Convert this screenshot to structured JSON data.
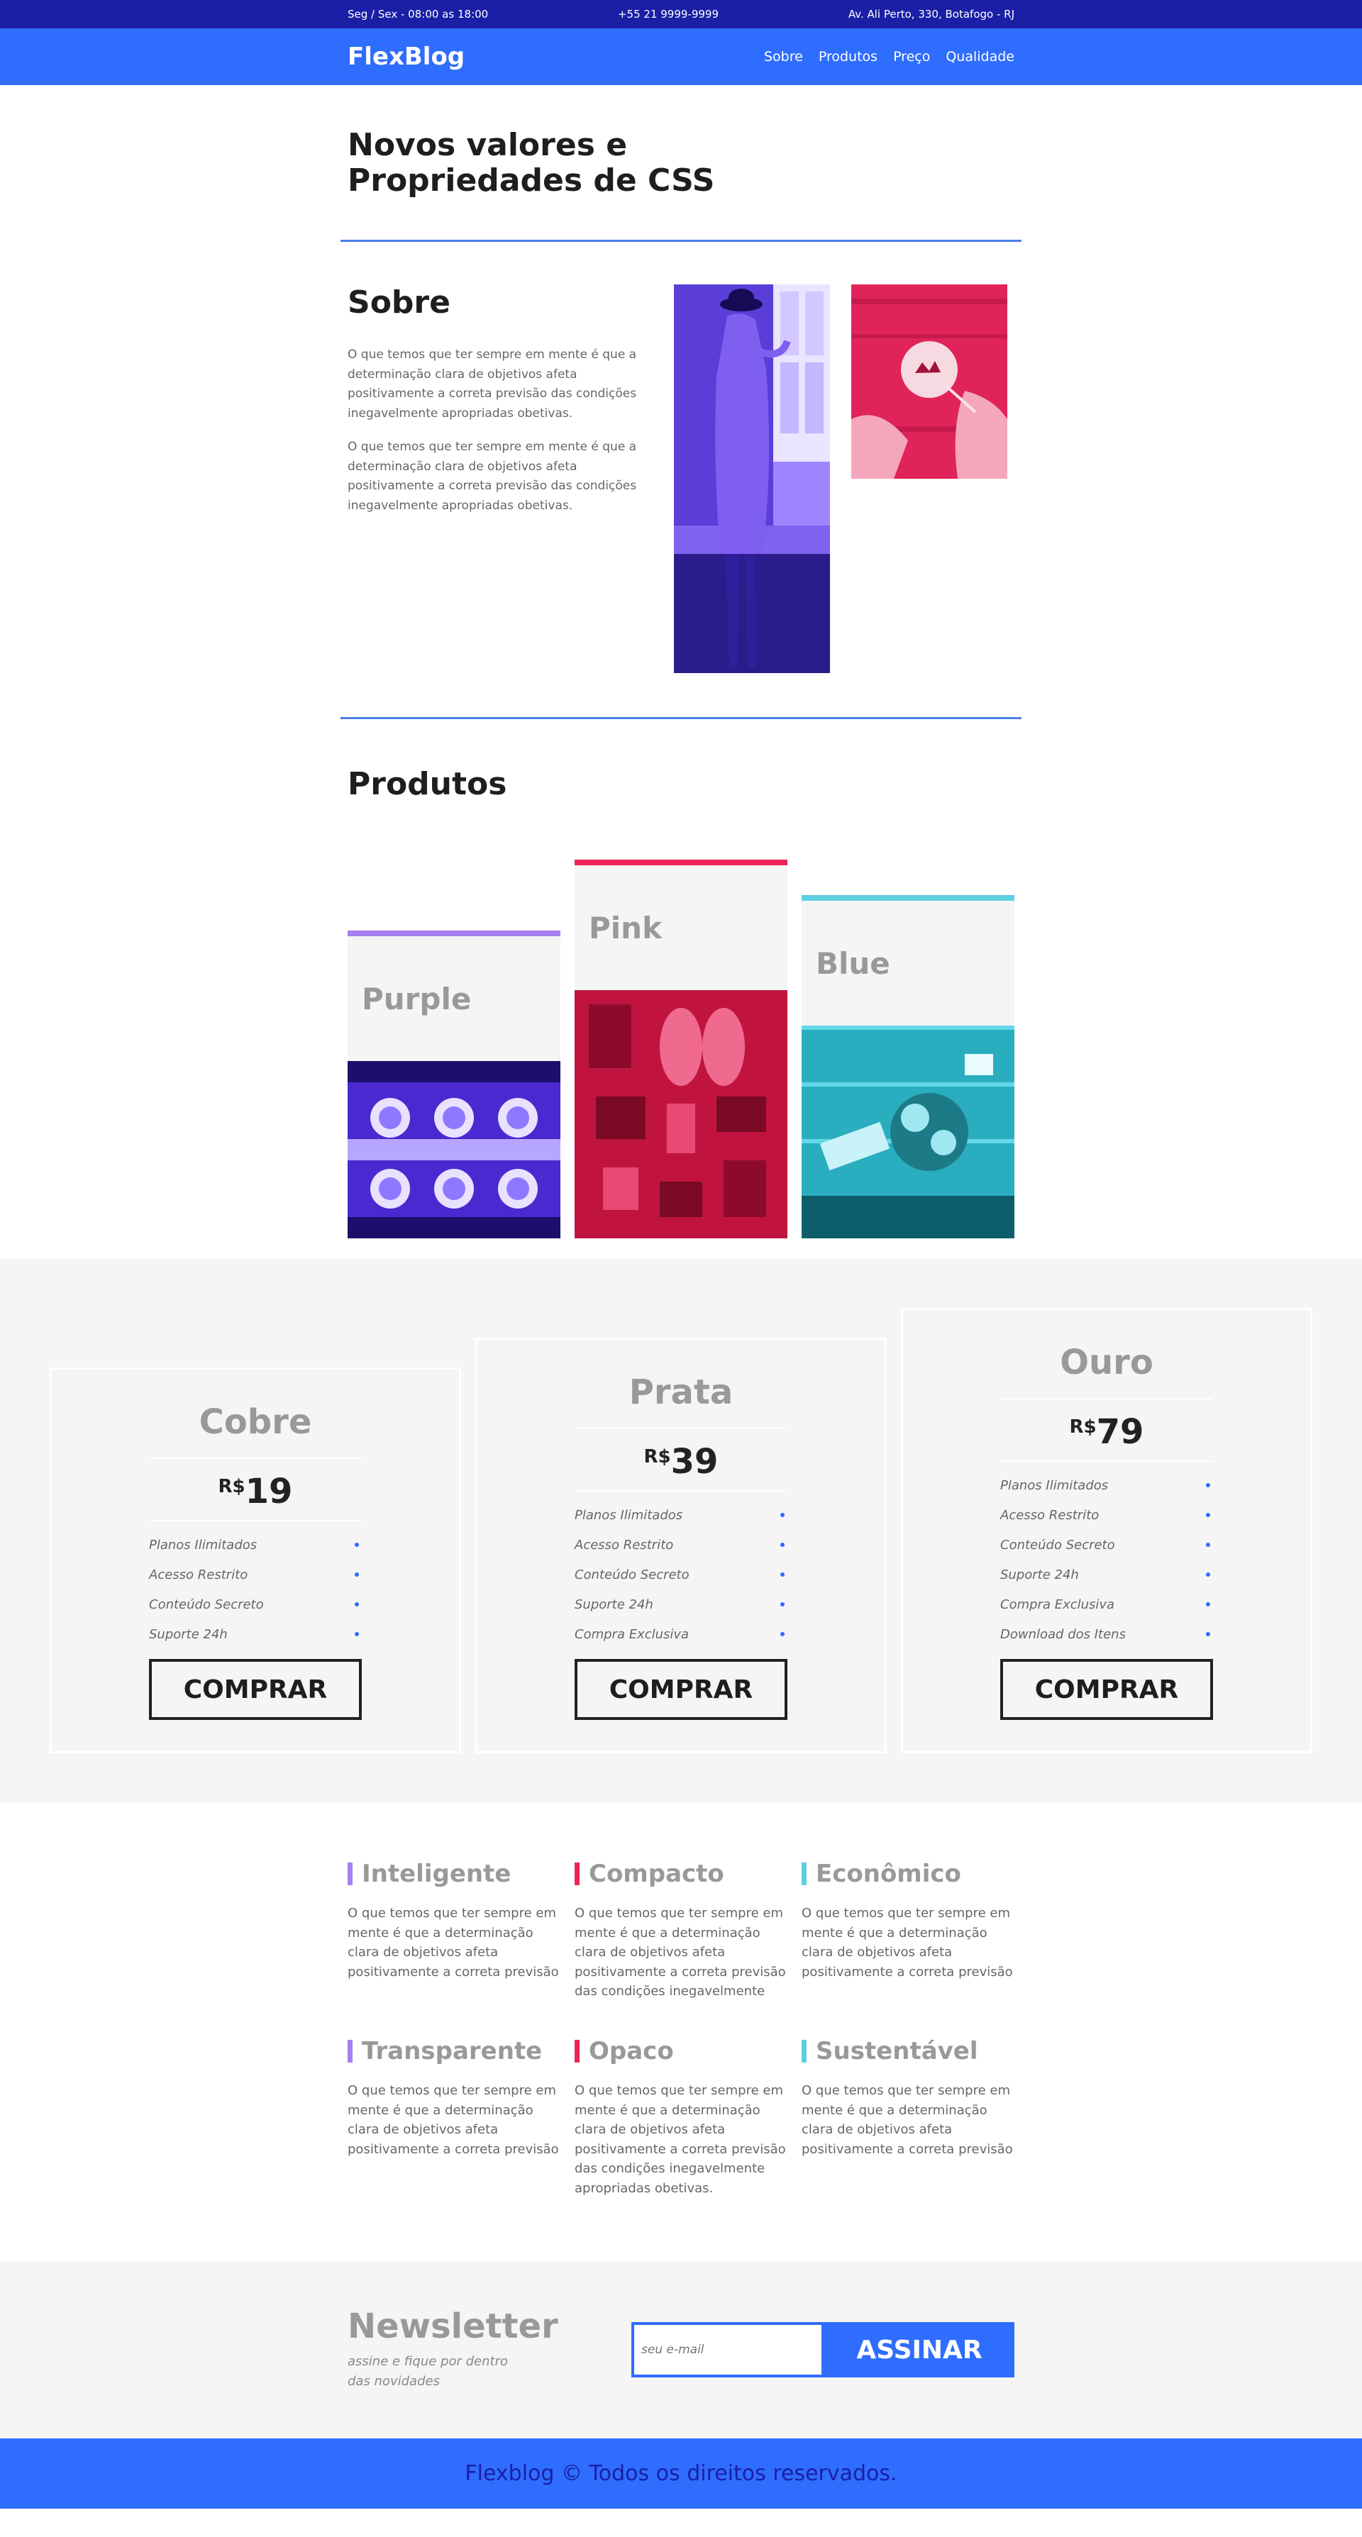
{
  "topbar": {
    "hours": "Seg / Sex - 08:00 as 18:00",
    "phone": "+55 21 9999-9999",
    "address": "Av. Ali Perto, 330, Botafogo - RJ"
  },
  "header": {
    "logo": "FlexBlog",
    "nav": [
      "Sobre",
      "Produtos",
      "Preço",
      "Qualidade"
    ]
  },
  "intro": {
    "title": "Novos valores e Propriedades de CSS"
  },
  "sobre": {
    "title": "Sobre",
    "paragraphs": [
      "O que temos que ter sempre em mente é que a determinação clara de objetivos afeta positivamente a correta previsão das condições inegavelmente apropriadas obetivas.",
      "O que temos que ter sempre em mente é que a determinação clara de objetivos afeta positivamente a correta previsão das condições inegavelmente apropriadas obetivas."
    ]
  },
  "produtos": {
    "title": "Produtos",
    "items": [
      {
        "name": "Purple",
        "color": "#a67ff0"
      },
      {
        "name": "Pink",
        "color": "#ee2356"
      },
      {
        "name": "Blue",
        "color": "#5ccfe0"
      }
    ]
  },
  "planos": {
    "items": [
      {
        "name": "Cobre",
        "currency": "R$",
        "price": "19",
        "features": [
          "Planos Ilimitados",
          "Acesso Restrito",
          "Conteúdo Secreto",
          "Suporte 24h"
        ],
        "button": "COMPRAR"
      },
      {
        "name": "Prata",
        "currency": "R$",
        "price": "39",
        "features": [
          "Planos Ilimitados",
          "Acesso Restrito",
          "Conteúdo Secreto",
          "Suporte 24h",
          "Compra Exclusiva"
        ],
        "button": "COMPRAR"
      },
      {
        "name": "Ouro",
        "currency": "R$",
        "price": "79",
        "features": [
          "Planos Ilimitados",
          "Acesso Restrito",
          "Conteúdo Secreto",
          "Suporte 24h",
          "Compra Exclusiva",
          "Download dos Itens"
        ],
        "button": "COMPRAR"
      }
    ]
  },
  "qualidades": {
    "items": [
      {
        "title": "Inteligente",
        "color": "#a67ff0",
        "text": "O que temos que ter sempre em mente é que a determinação clara de objetivos afeta positivamente a correta previsão"
      },
      {
        "title": "Compacto",
        "color": "#ee2356",
        "text": "O que temos que ter sempre em mente é que a determinação clara de objetivos afeta positivamente a correta previsão das condições inegavelmente"
      },
      {
        "title": "Econômico",
        "color": "#5ccfe0",
        "text": "O que temos que ter sempre em mente é que a determinação clara de objetivos afeta positivamente a correta previsão"
      },
      {
        "title": "Transparente",
        "color": "#a67ff0",
        "text": "O que temos que ter sempre em mente é que a determinação clara de objetivos afeta positivamente a correta previsão"
      },
      {
        "title": "Opaco",
        "color": "#ee2356",
        "text": "O que temos que ter sempre em mente é que a determinação clara de objetivos afeta positivamente a correta previsão das condições inegavelmente apropriadas obetivas."
      },
      {
        "title": "Sustentável",
        "color": "#5ccfe0",
        "text": "O que temos que ter sempre em mente é que a determinação clara de objetivos afeta positivamente a correta previsão"
      }
    ]
  },
  "newsletter": {
    "title": "Newsletter",
    "subtitle": "assine e fique por dentro das novidades",
    "placeholder": "seu e-mail",
    "button": "ASSINAR"
  },
  "footer": {
    "text": "Flexblog © Todos os direitos reservados."
  },
  "colors": {
    "dark_blue": "#1a1fa6",
    "brand_blue": "#2e6dfd",
    "purple": "#a67ff0",
    "pink": "#ee2356",
    "cyan": "#5ccfe0"
  }
}
